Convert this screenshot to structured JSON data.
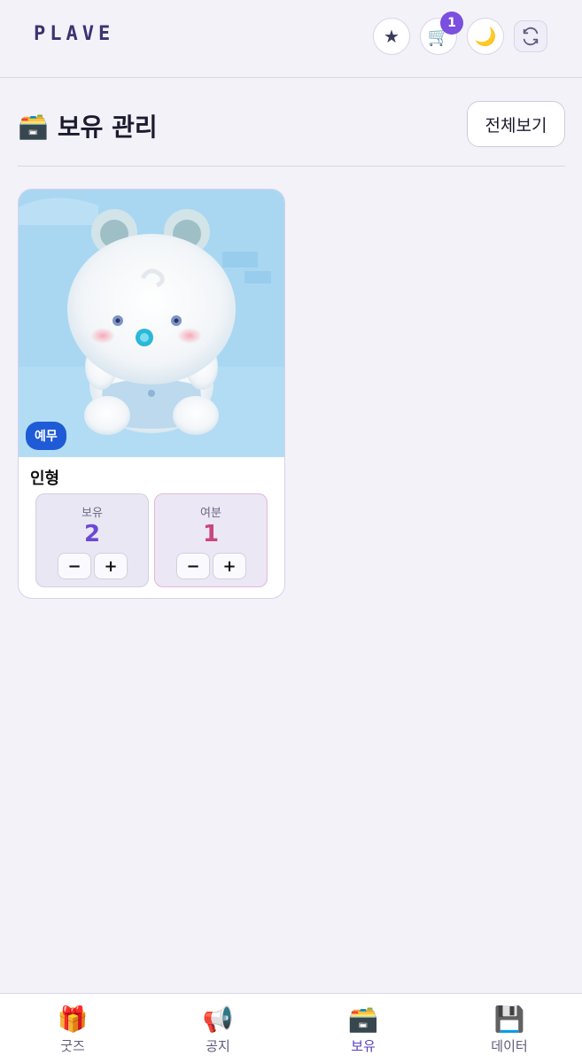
{
  "header": {
    "logo": "PLAVE",
    "icons": {
      "favorite": "★",
      "cart": "🛒",
      "theme": "🌙",
      "refresh": "⟳"
    },
    "cart_count": "1"
  },
  "section": {
    "icon": "🗃️",
    "title": "보유 관리",
    "view_all_label": "전체보기"
  },
  "items": [
    {
      "member": "예무",
      "name": "인형",
      "own_label": "보유",
      "own_count": "2",
      "extra_label": "여분",
      "extra_count": "1",
      "minus": "−",
      "plus": "+"
    }
  ],
  "bottom_nav": [
    {
      "icon": "🎁",
      "label": "굿즈",
      "active": false
    },
    {
      "icon": "📢",
      "label": "공지",
      "active": false
    },
    {
      "icon": "🗃️",
      "label": "보유",
      "active": true
    },
    {
      "icon": "💾",
      "label": "데이터",
      "active": false
    }
  ],
  "colors": {
    "accent": "#7b4fe0",
    "own_value": "#6b48d6",
    "extra_value": "#c9457d",
    "member_tag": "#1f5bd6"
  }
}
